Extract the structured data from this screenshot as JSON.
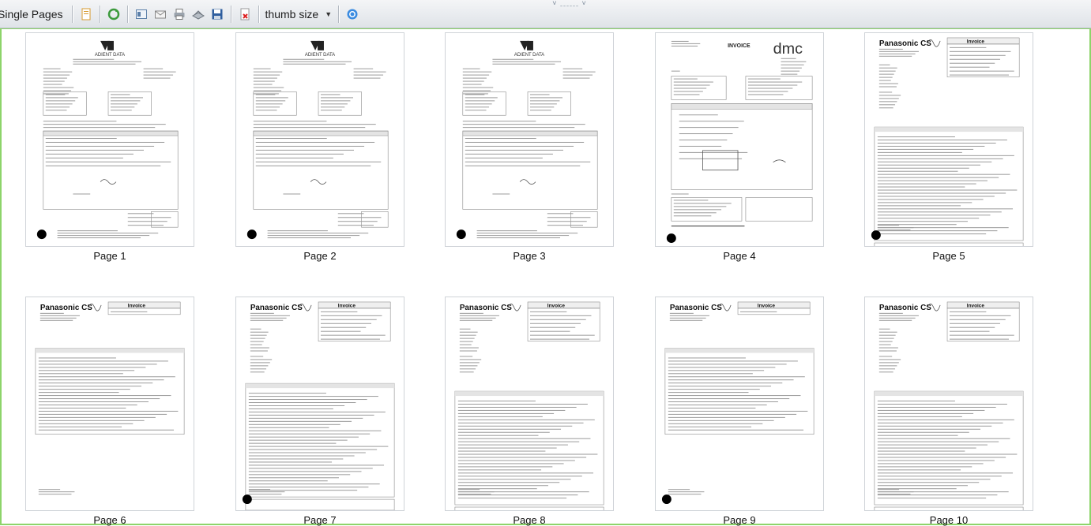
{
  "toolbar": {
    "view_mode_label": "Single Pages",
    "thumb_size_label": "thumb size",
    "top_handle": "˅ ˍˍˍˍˍˍ ˅"
  },
  "pages": [
    {
      "label": "Page 1",
      "kind": "adient"
    },
    {
      "label": "Page 2",
      "kind": "adient"
    },
    {
      "label": "Page 3",
      "kind": "adient"
    },
    {
      "label": "Page 4",
      "kind": "dmc"
    },
    {
      "label": "Page 5",
      "kind": "panasonic"
    },
    {
      "label": "Page 6",
      "kind": "panasonic"
    },
    {
      "label": "Page 7",
      "kind": "panasonic"
    },
    {
      "label": "Page 8",
      "kind": "panasonic"
    },
    {
      "label": "Page 9",
      "kind": "panasonic"
    },
    {
      "label": "Page 10",
      "kind": "panasonic"
    }
  ],
  "thumbnail_text": {
    "adient_logo": "ADIENT DATA",
    "dmc_title": "INVOICE",
    "dmc_logo": "dmc",
    "panasonic_logo": "Panasonic CS",
    "panasonic_title": "Invoice"
  },
  "colors": {
    "selection_border": "#8dd46a",
    "toolbar_bg": "#e6e9ed"
  }
}
